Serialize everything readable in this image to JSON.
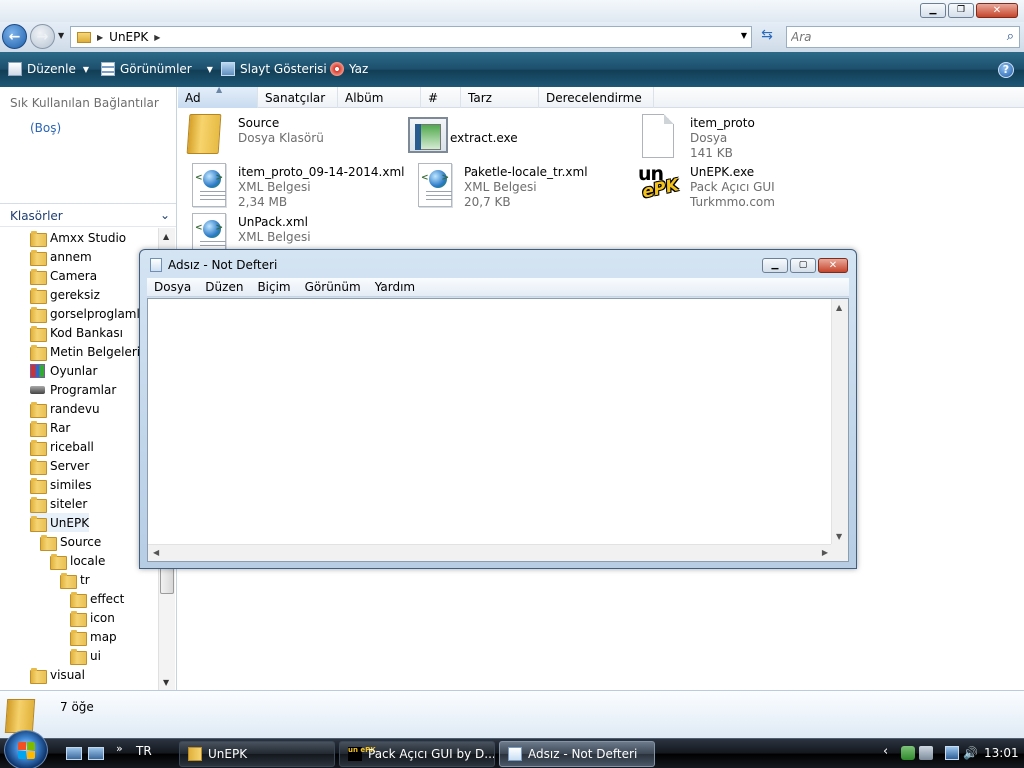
{
  "explorer": {
    "address": {
      "crumb": "UnEPK"
    },
    "search": {
      "placeholder": "Ara"
    },
    "toolbar": {
      "organize": "Düzenle",
      "views": "Görünümler",
      "slideshow": "Slayt Gösterisi",
      "burn": "Yaz",
      "help": "?"
    },
    "nav": {
      "favorites_title": "Sık Kullanılan Bağlantılar",
      "favorites_empty": "(Boş)",
      "folders_title": "Klasörler",
      "tree": [
        {
          "label": "Amxx Studio",
          "icon": "folder-icon",
          "depth": 0
        },
        {
          "label": "annem",
          "icon": "folder-icon",
          "depth": 0
        },
        {
          "label": "Camera",
          "icon": "folder-icon",
          "depth": 0
        },
        {
          "label": "gereksiz",
          "icon": "folder-icon",
          "depth": 0
        },
        {
          "label": "gorselproglamlar",
          "icon": "folder-icon",
          "depth": 0
        },
        {
          "label": "Kod Bankası",
          "icon": "folder-icon",
          "depth": 0
        },
        {
          "label": "Metin Belgelerim",
          "icon": "folder-icon",
          "depth": 0
        },
        {
          "label": "Oyunlar",
          "icon": "games-icon",
          "depth": 0
        },
        {
          "label": "Programlar",
          "icon": "drive-icon",
          "depth": 0
        },
        {
          "label": "randevu",
          "icon": "folder-icon",
          "depth": 0
        },
        {
          "label": "Rar",
          "icon": "folder-icon",
          "depth": 0
        },
        {
          "label": "riceball",
          "icon": "folder-icon",
          "depth": 0
        },
        {
          "label": "Server",
          "icon": "folder-icon",
          "depth": 0
        },
        {
          "label": "similes",
          "icon": "folder-icon",
          "depth": 0
        },
        {
          "label": "siteler",
          "icon": "folder-icon",
          "depth": 0
        },
        {
          "label": "UnEPK",
          "icon": "folder-icon",
          "depth": 0,
          "selected": true
        },
        {
          "label": "Source",
          "icon": "folder-icon",
          "depth": 1
        },
        {
          "label": "locale",
          "icon": "folder-icon",
          "depth": 2
        },
        {
          "label": "tr",
          "icon": "folder-icon",
          "depth": 3
        },
        {
          "label": "effect",
          "icon": "folder-icon",
          "depth": 4
        },
        {
          "label": "icon",
          "icon": "folder-icon",
          "depth": 4
        },
        {
          "label": "map",
          "icon": "folder-icon",
          "depth": 4
        },
        {
          "label": "ui",
          "icon": "folder-icon",
          "depth": 4
        },
        {
          "label": "visual",
          "icon": "folder-icon",
          "depth": 0
        }
      ]
    },
    "columns": [
      "Ad",
      "Sanatçılar",
      "Albüm",
      "#",
      "Tarz",
      "Derecelendirme"
    ],
    "files": [
      {
        "name": "Source",
        "line2": "Dosya Klasörü",
        "line3": "",
        "icon": "folder-icon"
      },
      {
        "name": "extract.exe",
        "line2": "",
        "line3": "",
        "icon": "exe-icon"
      },
      {
        "name": "item_proto",
        "line2": "Dosya",
        "line3": "141 KB",
        "icon": "file-icon"
      },
      {
        "name": "item_proto_09-14-2014.xml",
        "line2": "XML Belgesi",
        "line3": "2,34 MB",
        "icon": "xml-icon"
      },
      {
        "name": "Paketle-locale_tr.xml",
        "line2": "XML Belgesi",
        "line3": "20,7 KB",
        "icon": "xml-icon"
      },
      {
        "name": "UnEPK.exe",
        "line2": "Pack Açıcı GUI",
        "line3": "Turkmmo.com",
        "icon": "unepk-icon"
      },
      {
        "name": "UnPack.xml",
        "line2": "XML Belgesi",
        "line3": "",
        "icon": "xml-icon"
      }
    ],
    "details": {
      "count": "7 öğe"
    }
  },
  "notepad": {
    "title": "Adsız - Not Defteri",
    "menu": [
      "Dosya",
      "Düzen",
      "Biçim",
      "Görünüm",
      "Yardım"
    ],
    "content": ""
  },
  "taskbar": {
    "language": "TR",
    "tasks": [
      {
        "label": "UnEPK",
        "icon": "folder-icon",
        "active": false
      },
      {
        "label": "Pack Açıcı GUI by D...",
        "icon": "unepk-icon",
        "active": false
      },
      {
        "label": "Adsız - Not Defteri",
        "icon": "notepad-icon",
        "active": true
      }
    ],
    "clock": "13:01"
  }
}
